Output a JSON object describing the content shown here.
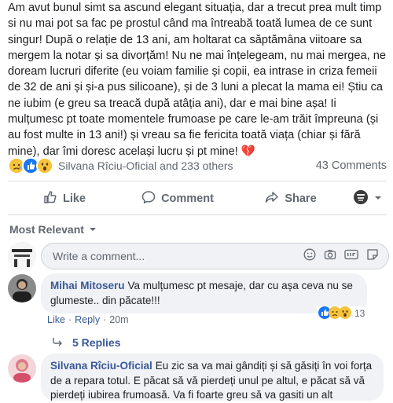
{
  "post": {
    "text": "Am avut bunul simt sa ascund elegant situația, dar a trecut prea mult timp si nu mai pot sa fac pe prostul când ma întreabă toată lumea de ce sunt singur! După o relație de 13 ani, am holtarat ca săptămâna viitoare sa mergem la notar și sa divorțăm! Nu ne mai înțelegeam, nu mai mergea, ne doream lucruri diferite (eu voiam familie și copii, ea intrase in criza femeii de 32 de ani și și-a pus silicoane), și de 3 luni a plecat la mama ei! Știu ca ne iubim (e greu sa treacă după atâția ani), dar e mai bine așa! Ii mulțumesc pt toate momentele frumoase pe care le-am trăit împreuna (și au fost multe in 13 ani!) și vreau sa fie fericita toată viața (chiar și fără mine), dar îmi doresc același lucru și pt mine! 💔"
  },
  "reactions": {
    "icons": [
      "sad-reaction-icon",
      "like-reaction-icon",
      "wow-reaction-icon"
    ],
    "summary": "Silvana Rîciu-Oficial and 233 others",
    "comments_count": "43 Comments"
  },
  "actions": {
    "like": "Like",
    "comment": "Comment",
    "share": "Share"
  },
  "sort": {
    "label": "Most Relevant"
  },
  "composer": {
    "placeholder": "Write a comment..."
  },
  "comments": [
    {
      "author": "Mihai Mitoseru",
      "text": "Va mulțumesc pt mesaje, dar cu așa ceva nu se glumeste.. din păcate!!!",
      "like": "Like",
      "reply": "Reply",
      "time": "20m",
      "reaction_count": "13",
      "replies_label": "5 Replies"
    },
    {
      "author": "Silvana Rîciu-Oficial",
      "text": "Eu zic sa va mai gândiți și să găsiți în voi forța de a repara totul. E păcat să vă pierdeți unul pe altul, e păcat să vă pierdeți iubirea frumoasă. Va fi foarte greu să va gasiti un alt"
    }
  ],
  "colors": {
    "link": "#385898",
    "accent": "#1877f2",
    "muted": "#606770",
    "bubble": "#f0f2f5",
    "heart": "#e0245e"
  }
}
